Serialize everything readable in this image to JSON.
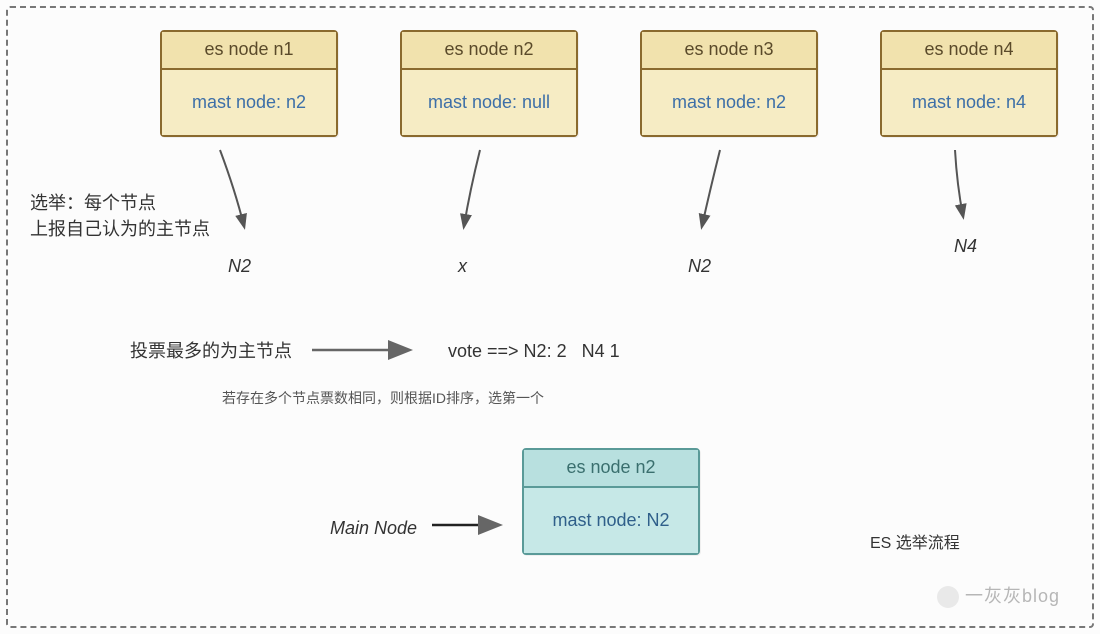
{
  "nodes": {
    "n1": {
      "title": "es node n1",
      "body": "mast node: n2"
    },
    "n2": {
      "title": "es node n2",
      "body": "mast node: null"
    },
    "n3": {
      "title": "es node n3",
      "body": "mast node: n2"
    },
    "n4": {
      "title": "es node n4",
      "body": "mast node: n4"
    }
  },
  "election_label": "选举：每个节点\n上报自己认为的主节点",
  "votes": {
    "n1": "N2",
    "n2": "x",
    "n3": "N2",
    "n4": "N4"
  },
  "tally_label": "投票最多的为主节点",
  "tally_result": "vote ==> N2: 2   N4 1",
  "tiebreak_note": "若存在多个节点票数相同，则根据ID排序，选第一个",
  "main_node_label": "Main Node",
  "result_node": {
    "title": "es node n2",
    "body": "mast node: N2"
  },
  "footer_caption": "ES 选举流程",
  "watermark": "一灰灰blog"
}
